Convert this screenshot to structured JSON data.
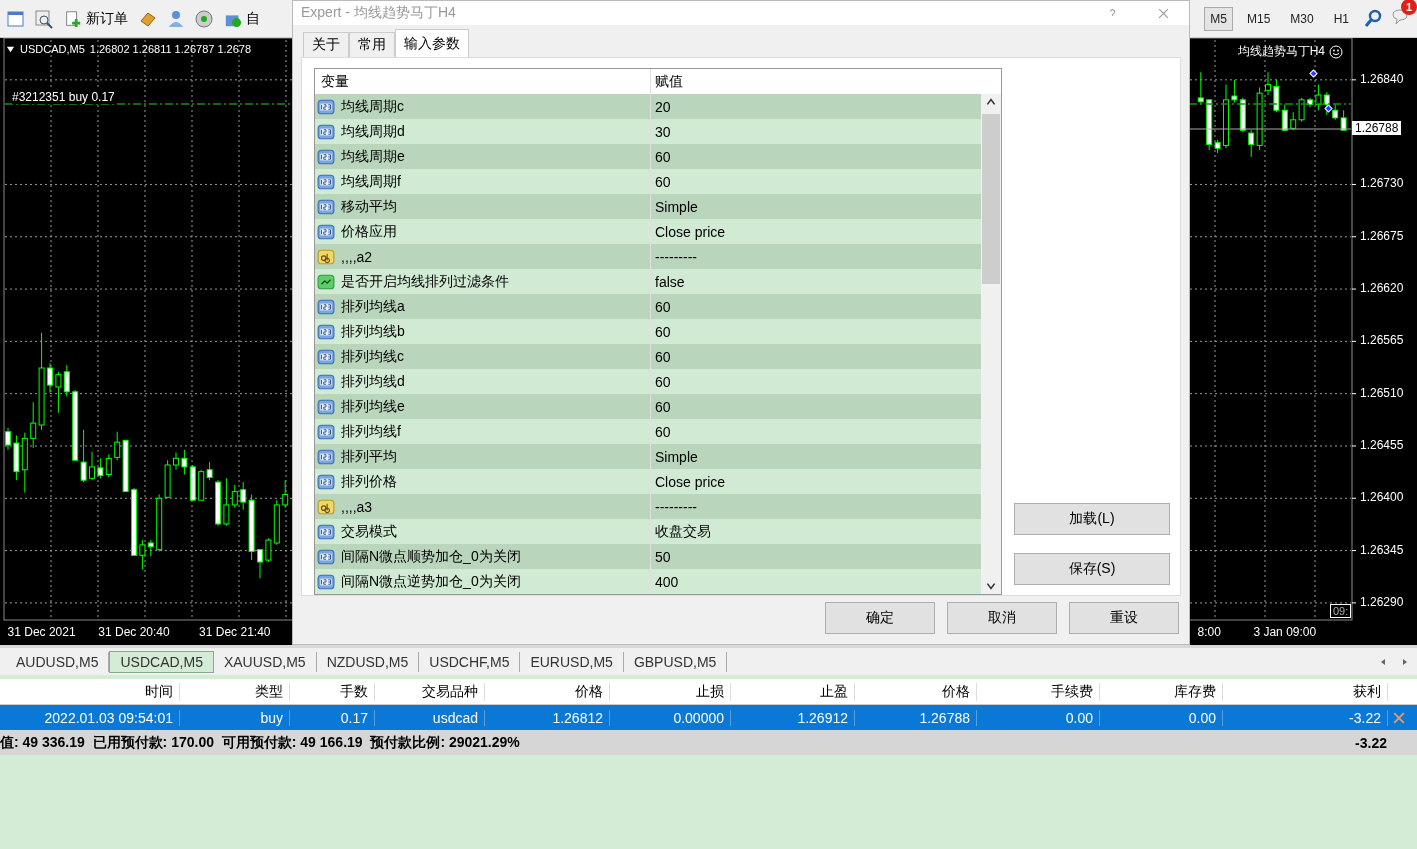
{
  "toolbar": {
    "new_order": "新订单",
    "auto_trading": "自"
  },
  "timeframes": [
    {
      "label": "M5",
      "selected": true
    },
    {
      "label": "M15",
      "selected": false
    },
    {
      "label": "M30",
      "selected": false
    },
    {
      "label": "H1",
      "selected": false
    }
  ],
  "notifications": {
    "badge": "1"
  },
  "chart": {
    "symbol": "USDCAD,M5",
    "quotes": "1.26802 1.26811 1.26787 1.2678",
    "expert": "均线趋势马丁H4",
    "time_box": "09:",
    "chart_data": {
      "type": "candlestick",
      "grid": true,
      "ylim": [
        1.26272,
        1.26884
      ],
      "categories": [
        null,
        null,
        null,
        null,
        "31 Dec 2021",
        null,
        null,
        null,
        null,
        null,
        null,
        null,
        null,
        null,
        null,
        "31 Dec 20:40",
        null,
        null,
        null,
        null,
        null,
        null,
        null,
        null,
        null,
        null,
        null,
        "31 Dec 21:40",
        null,
        null,
        null,
        null,
        null,
        null,
        null,
        null,
        null,
        null,
        null,
        null,
        null,
        null,
        null,
        null,
        null,
        null,
        null,
        null,
        null,
        null,
        null,
        null,
        null,
        null,
        null,
        null,
        null,
        null,
        null,
        null,
        null,
        null,
        null,
        null,
        null,
        null,
        null,
        null,
        null,
        null,
        null,
        null,
        null,
        null,
        null,
        null,
        null,
        null,
        null,
        null,
        null,
        null,
        null,
        null,
        null,
        null,
        null,
        null,
        null,
        null,
        null,
        null,
        null,
        null,
        null,
        null,
        null,
        null,
        null,
        null,
        null,
        null,
        null,
        null,
        null,
        null,
        null,
        null,
        null,
        null,
        null,
        null,
        null,
        null,
        null,
        null,
        null,
        null,
        null,
        null,
        null,
        null,
        null,
        null,
        null,
        null,
        null,
        null,
        null,
        null,
        null,
        null,
        null,
        null,
        null,
        null,
        null,
        null,
        null,
        null,
        null,
        null,
        null,
        "8:00",
        null,
        null,
        null,
        null,
        null,
        null,
        null,
        null,
        "3 Jan 09:00",
        null,
        null,
        null,
        null,
        null,
        null,
        null
      ],
      "ohlc": [
        [
          1.2647,
          1.26474,
          1.26451,
          1.26456
        ],
        [
          1.26458,
          1.26466,
          1.26419,
          1.26428
        ],
        [
          1.2643,
          1.26469,
          1.26406,
          1.26463
        ],
        [
          1.26463,
          1.26501,
          1.26453,
          1.26479
        ],
        [
          1.26477,
          1.26574,
          1.26472,
          1.26537
        ],
        [
          1.26537,
          1.26542,
          1.26511,
          1.26519
        ],
        [
          1.26517,
          1.26533,
          1.2649,
          1.2653
        ],
        [
          1.26533,
          1.2654,
          1.26507,
          1.26512
        ],
        [
          1.26512,
          1.26514,
          1.2644,
          1.2644
        ],
        [
          1.26438,
          1.26472,
          1.26417,
          1.26419
        ],
        [
          1.26421,
          1.26449,
          1.26419,
          1.26433
        ],
        [
          1.26432,
          1.26442,
          1.26421,
          1.26424
        ],
        [
          1.26425,
          1.26446,
          1.26422,
          1.26442
        ],
        [
          1.26443,
          1.2647,
          1.2644,
          1.26459
        ],
        [
          1.26461,
          1.26461,
          1.26407,
          1.26407
        ],
        [
          1.26409,
          1.26411,
          1.2634,
          1.2634
        ],
        [
          1.2634,
          1.26356,
          1.26325,
          1.26351
        ],
        [
          1.26353,
          1.26356,
          1.26339,
          1.26349
        ],
        [
          1.26346,
          1.26404,
          1.26344,
          1.264
        ],
        [
          1.26401,
          1.2644,
          1.264,
          1.26435
        ],
        [
          1.26435,
          1.26448,
          1.2643,
          1.26442
        ],
        [
          1.26442,
          1.26451,
          1.26425,
          1.26433
        ],
        [
          1.26433,
          1.26435,
          1.26398,
          1.26398
        ],
        [
          1.26398,
          1.2643,
          1.26398,
          1.26428
        ],
        [
          1.2643,
          1.26438,
          1.26419,
          1.26422
        ],
        [
          1.26417,
          1.26419,
          1.26371,
          1.26373
        ],
        [
          1.26373,
          1.26421,
          1.26371,
          1.26393
        ],
        [
          1.26393,
          1.26414,
          1.2639,
          1.26407
        ],
        [
          1.26409,
          1.26417,
          1.26388,
          1.26396
        ],
        [
          1.26398,
          1.26404,
          1.26335,
          1.26344
        ],
        [
          1.26346,
          1.26346,
          1.26316,
          1.26333
        ],
        [
          1.26335,
          1.26358,
          1.26333,
          1.26356
        ],
        [
          1.26353,
          1.26398,
          1.26351,
          1.26393
        ],
        [
          1.26393,
          1.26419,
          1.2639,
          1.26404
        ],
        null,
        null,
        null,
        null,
        null,
        null,
        null,
        null,
        null,
        null,
        null,
        null,
        null,
        null,
        null,
        null,
        null,
        null,
        null,
        null,
        null,
        null,
        null,
        null,
        null,
        null,
        null,
        null,
        null,
        null,
        null,
        null,
        null,
        null,
        null,
        null,
        null,
        null,
        null,
        null,
        null,
        null,
        null,
        null,
        null,
        null,
        null,
        null,
        null,
        null,
        null,
        null,
        null,
        null,
        null,
        null,
        null,
        null,
        null,
        null,
        null,
        null,
        null,
        null,
        null,
        null,
        null,
        null,
        null,
        null,
        null,
        null,
        null,
        null,
        null,
        null,
        null,
        null,
        null,
        null,
        null,
        null,
        null,
        null,
        null,
        null,
        null,
        null,
        null,
        null,
        null,
        null,
        null,
        null,
        null,
        null,
        null,
        null,
        null,
        null,
        null,
        null,
        null,
        null,
        null,
        null,
        null,
        null,
        [
          1.26821,
          1.26848,
          1.26814,
          1.26817
        ],
        [
          1.26819,
          1.26819,
          1.26766,
          1.26772
        ],
        [
          1.26774,
          1.26777,
          1.26763,
          1.26768
        ],
        [
          1.26771,
          1.26835,
          1.26768,
          1.26819
        ],
        [
          1.26823,
          1.2684,
          1.26816,
          1.26819
        ],
        [
          1.26819,
          1.26821,
          1.26785,
          1.26787
        ],
        [
          1.26784,
          1.26787,
          1.26759,
          1.26772
        ],
        [
          1.26771,
          1.26832,
          1.26766,
          1.26826
        ],
        [
          1.26829,
          1.26848,
          1.26824,
          1.26835
        ],
        [
          1.26833,
          1.2684,
          1.26806,
          1.26808
        ],
        [
          1.26808,
          1.26814,
          1.26787,
          1.26787
        ],
        [
          1.26789,
          1.26806,
          1.26787,
          1.26798
        ],
        [
          1.26798,
          1.26821,
          1.26796,
          1.26819
        ],
        [
          1.26819,
          1.26821,
          1.26811,
          1.26814
        ],
        [
          1.26814,
          1.26835,
          1.26808,
          1.26824
        ],
        [
          1.26824,
          1.26827,
          1.26803,
          1.26814
        ],
        [
          1.26808,
          1.26814,
          1.26798,
          1.268
        ],
        [
          1.268,
          1.26808,
          1.26787,
          1.26787
        ]
      ],
      "yticks": [
        {
          "value": 1.2684,
          "label": "1.26840"
        },
        {
          "value": 1.2673,
          "label": "1.26730"
        },
        {
          "value": 1.26675,
          "label": "1.26675"
        },
        {
          "value": 1.2662,
          "label": "1.26620"
        },
        {
          "value": 1.26565,
          "label": "1.26565"
        },
        {
          "value": 1.2651,
          "label": "1.26510"
        },
        {
          "value": 1.26455,
          "label": "1.26455"
        },
        {
          "value": 1.264,
          "label": "1.26400"
        },
        {
          "value": 1.26345,
          "label": "1.26345"
        },
        {
          "value": 1.2629,
          "label": "1.26290"
        }
      ]
    },
    "order_line": "#3212351 buy 0.17",
    "current_price": "1.26788"
  },
  "dialog": {
    "title": "Expert - 均线趋势马丁H4",
    "tabs": [
      {
        "label": "关于",
        "selected": false
      },
      {
        "label": "常用",
        "selected": false
      },
      {
        "label": "输入参数",
        "selected": true
      }
    ],
    "columns": [
      "变量",
      "赋值"
    ],
    "rows": [
      {
        "kind": "int",
        "name": "均线周期c",
        "value": "20"
      },
      {
        "kind": "int",
        "name": "均线周期d",
        "value": "30"
      },
      {
        "kind": "int",
        "name": "均线周期e",
        "value": "60"
      },
      {
        "kind": "int",
        "name": "均线周期f",
        "value": "60"
      },
      {
        "kind": "int",
        "name": "移动平均",
        "value": "Simple"
      },
      {
        "kind": "int",
        "name": "价格应用",
        "value": "Close price"
      },
      {
        "kind": "string",
        "name": ",,,,a2",
        "value": "---------"
      },
      {
        "kind": "bool",
        "name": "是否开启均线排列过滤条件",
        "value": "false"
      },
      {
        "kind": "int",
        "name": "排列均线a",
        "value": "60"
      },
      {
        "kind": "int",
        "name": "排列均线b",
        "value": "60"
      },
      {
        "kind": "int",
        "name": "排列均线c",
        "value": "60"
      },
      {
        "kind": "int",
        "name": "排列均线d",
        "value": "60"
      },
      {
        "kind": "int",
        "name": "排列均线e",
        "value": "60"
      },
      {
        "kind": "int",
        "name": "排列均线f",
        "value": "60"
      },
      {
        "kind": "int",
        "name": "排列平均",
        "value": "Simple"
      },
      {
        "kind": "int",
        "name": "排列价格",
        "value": "Close price"
      },
      {
        "kind": "string",
        "name": ",,,,a3",
        "value": "---------"
      },
      {
        "kind": "int",
        "name": "交易模式",
        "value": "收盘交易"
      },
      {
        "kind": "int",
        "name": "间隔N微点顺势加仓_0为关闭",
        "value": "50"
      },
      {
        "kind": "int",
        "name": "间隔N微点逆势加仓_0为关闭",
        "value": "400"
      }
    ],
    "side_buttons": [
      "加载(L)",
      "保存(S)"
    ],
    "buttons": [
      "确定",
      "取消",
      "重设"
    ]
  },
  "chart_tabs": [
    {
      "label": "AUDUSD,M5",
      "selected": false
    },
    {
      "label": "USDCAD,M5",
      "selected": true
    },
    {
      "label": "XAUUSD,M5",
      "selected": false
    },
    {
      "label": "NZDUSD,M5",
      "selected": false
    },
    {
      "label": "USDCHF,M5",
      "selected": false
    },
    {
      "label": "EURUSD,M5",
      "selected": false
    },
    {
      "label": "GBPUSD,M5",
      "selected": false
    }
  ],
  "trades": {
    "columns": [
      "时间",
      "类型",
      "手数",
      "交易品种",
      "价格",
      "止损",
      "止盈",
      "价格",
      "手续费",
      "库存费",
      "获利"
    ],
    "rows": [
      {
        "selected": true,
        "cells": [
          "2022.01.03 09:54:01",
          "buy",
          "0.17",
          "usdcad",
          "1.26812",
          "0.00000",
          "1.26912",
          "1.26788",
          "0.00",
          "0.00",
          "-3.22"
        ]
      }
    ],
    "summary": "值: 49 336.19  已用预付款: 170.00  可用预付款: 49 166.19  预付款比例: 29021.29%",
    "summary_profit": "-3.22"
  }
}
